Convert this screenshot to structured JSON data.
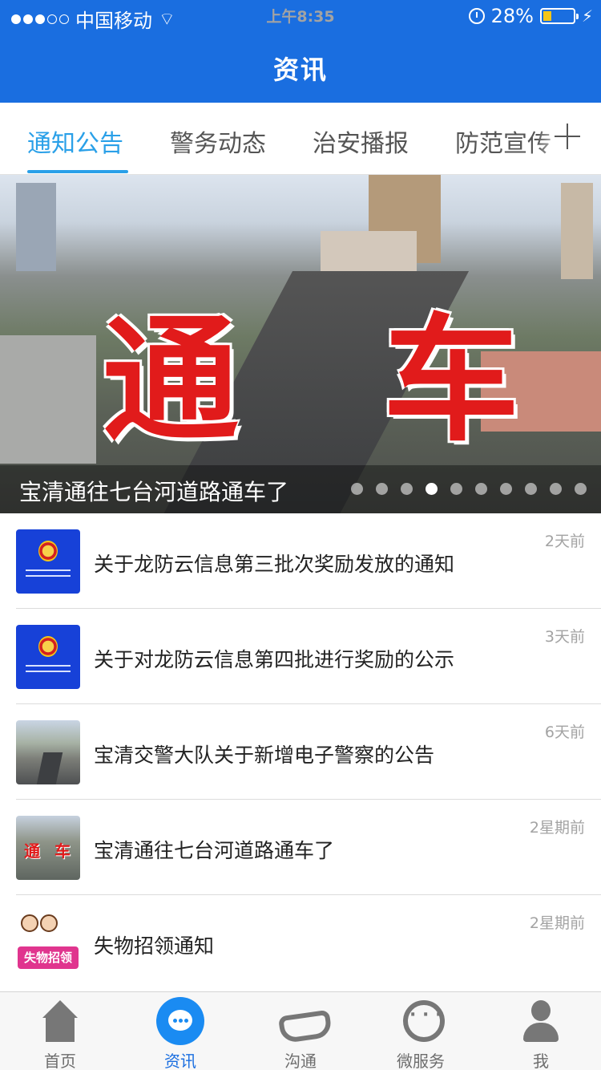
{
  "status": {
    "carrier": "中国移动",
    "time": "上午8:35",
    "battery": "28%",
    "battery_level": 0.28
  },
  "header": {
    "title": "资讯"
  },
  "tabs": [
    {
      "label": "通知公告",
      "active": true
    },
    {
      "label": "警务动态",
      "active": false
    },
    {
      "label": "治安播报",
      "active": false
    },
    {
      "label": "防范宣传",
      "active": false
    }
  ],
  "banner": {
    "overlay_text_1": "通",
    "overlay_text_2": "车",
    "caption": "宝清通往七台河道路通车了",
    "page_count": 10,
    "current_page": 4
  },
  "news": [
    {
      "title": "关于龙防云信息第三批次奖励发放的通知",
      "time": "2天前",
      "thumb": "police-emblem"
    },
    {
      "title": "关于对龙防云信息第四批进行奖励的公示",
      "time": "3天前",
      "thumb": "police-emblem"
    },
    {
      "title": "宝清交警大队关于新增电子警察的公告",
      "time": "6天前",
      "thumb": "street-photo"
    },
    {
      "title": "宝清通往七台河道路通车了",
      "time": "2星期前",
      "thumb": "tongche-photo"
    },
    {
      "title": "失物招领通知",
      "time": "2星期前",
      "thumb": "lost-and-found",
      "thumb_text": "失物招领"
    }
  ],
  "bottom_nav": [
    {
      "label": "首页",
      "icon": "home-icon",
      "active": false
    },
    {
      "label": "资讯",
      "icon": "chat-bubble-icon",
      "active": true
    },
    {
      "label": "沟通",
      "icon": "handshake-icon",
      "active": false
    },
    {
      "label": "微服务",
      "icon": "headset-service-icon",
      "active": false
    },
    {
      "label": "我",
      "icon": "person-icon",
      "active": false
    }
  ],
  "colors": {
    "header": "#1a6ee0",
    "tab_active": "#2aa0e8",
    "nav_active": "#1a6ee0"
  }
}
